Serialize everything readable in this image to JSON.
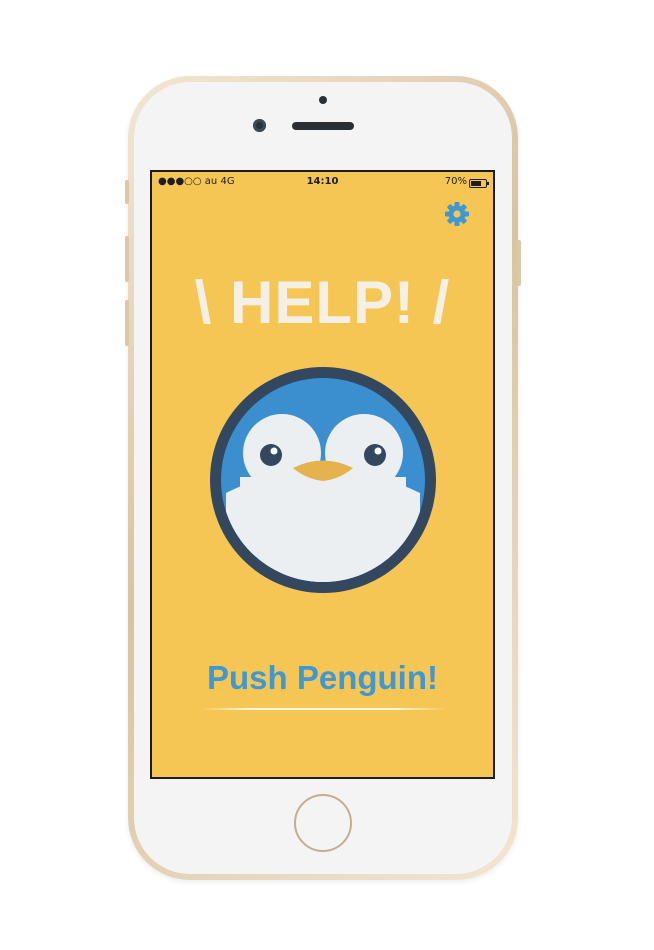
{
  "status_bar": {
    "carrier": "●●●○○ au  4G",
    "time": "14:10",
    "battery_percent": "70%",
    "battery_level": 0.7
  },
  "toolbar": {
    "settings_icon": "gear-icon"
  },
  "main": {
    "title": "\\ HELP! /",
    "push_label": "Push Penguin!"
  },
  "colors": {
    "screen_bg": "#f6c655",
    "title": "#f4f0e6",
    "accent_blue": "#3d98d3",
    "penguin_ring": "#33485e",
    "penguin_blue": "#3b8fce",
    "penguin_face": "#eceff1",
    "beak": "#e6b24e"
  }
}
